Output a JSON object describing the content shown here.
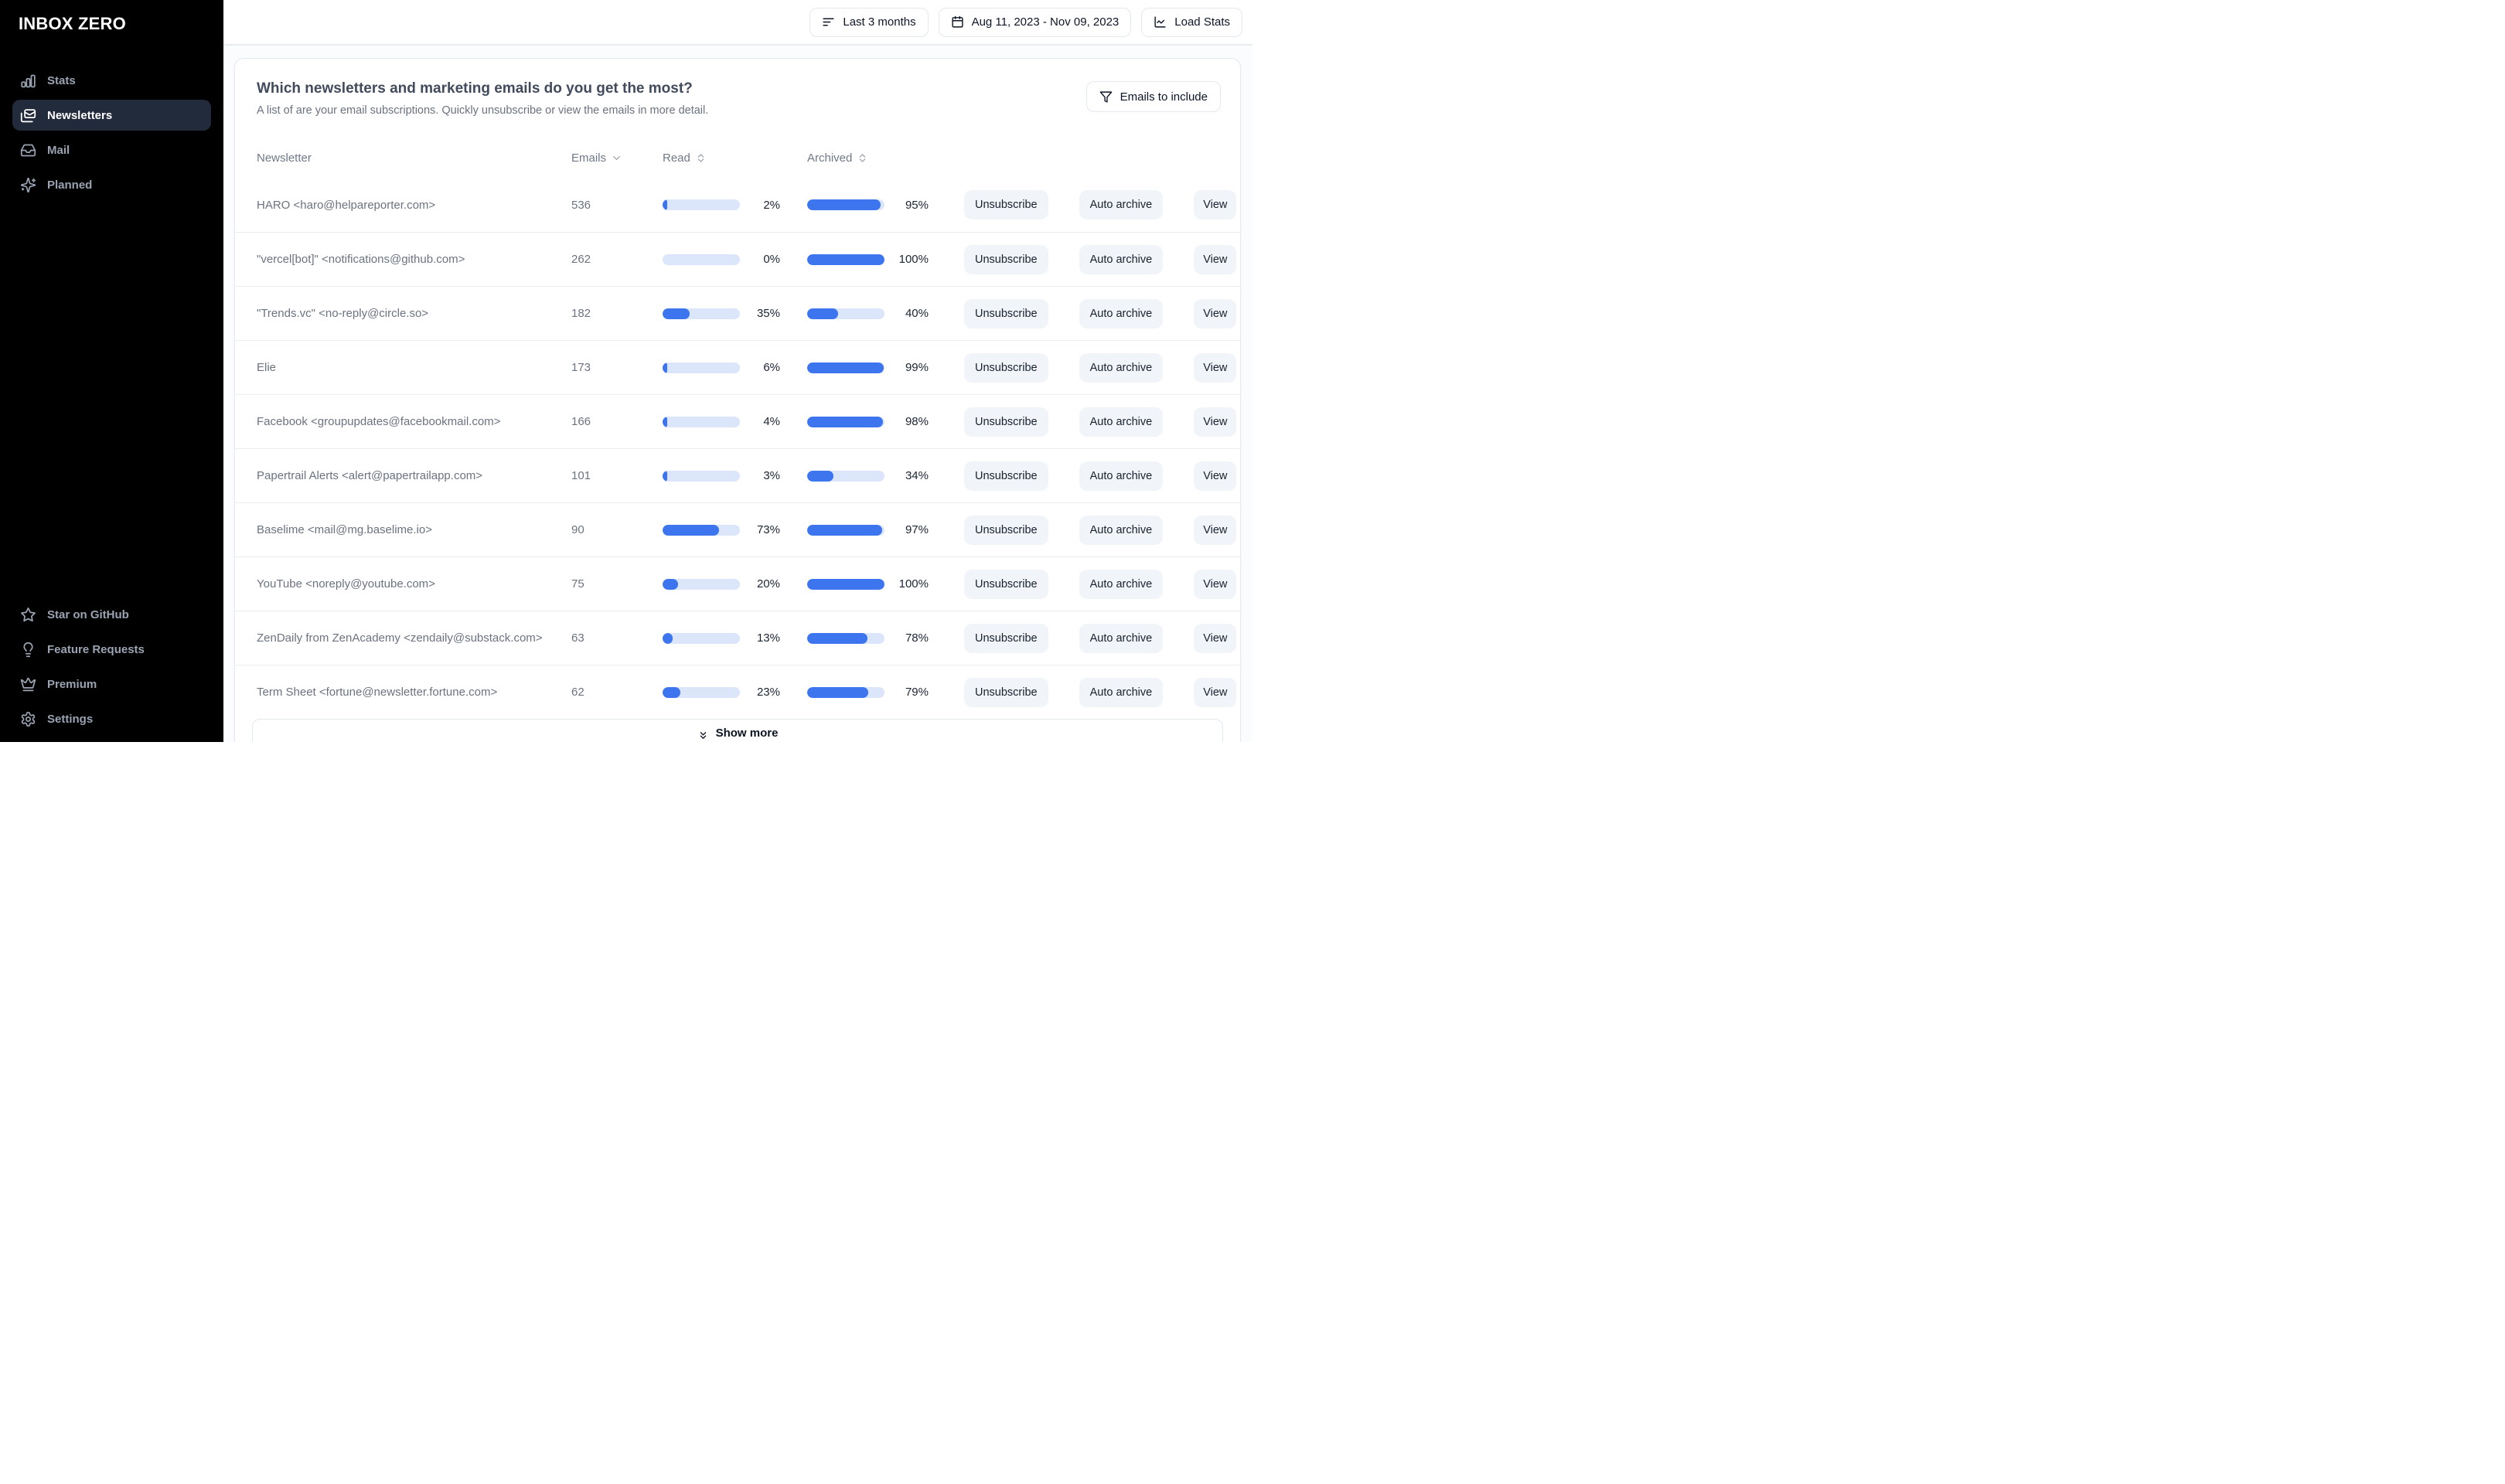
{
  "sidebar": {
    "logo": "INBOX ZERO",
    "nav": [
      {
        "label": "Stats",
        "icon": "bar-chart-icon",
        "active": false
      },
      {
        "label": "Newsletters",
        "icon": "envelope-icon",
        "active": true
      },
      {
        "label": "Mail",
        "icon": "inbox-icon",
        "active": false
      },
      {
        "label": "Planned",
        "icon": "sparkles-icon",
        "active": false
      }
    ],
    "footer_nav": [
      {
        "label": "Star on GitHub",
        "icon": "star-icon"
      },
      {
        "label": "Feature Requests",
        "icon": "lightbulb-icon"
      },
      {
        "label": "Premium",
        "icon": "crown-icon"
      },
      {
        "label": "Settings",
        "icon": "gear-icon"
      }
    ]
  },
  "topbar": {
    "range_button": "Last 3 months",
    "date_button": "Aug 11, 2023 - Nov 09, 2023",
    "load_stats_button": "Load Stats"
  },
  "panel": {
    "title": "Which newsletters and marketing emails do you get the most?",
    "subtitle": "A list of are your email subscriptions. Quickly unsubscribe or view the emails in more detail.",
    "filter_button": "Emails to include",
    "table": {
      "columns": [
        "Newsletter",
        "Emails",
        "Read",
        "Archived"
      ],
      "actions": [
        "Unsubscribe",
        "Auto archive",
        "View"
      ],
      "show_more": "Show more",
      "rows": [
        {
          "name": "HARO <haro@helpareporter.com>",
          "emails": "536",
          "read_pct": 2,
          "archived_pct": 95
        },
        {
          "name": "\"vercel[bot]\" <notifications@github.com>",
          "emails": "262",
          "read_pct": 0,
          "archived_pct": 100
        },
        {
          "name": "\"Trends.vc\" <no-reply@circle.so>",
          "emails": "182",
          "read_pct": 35,
          "archived_pct": 40
        },
        {
          "name": "Elie",
          "emails": "173",
          "read_pct": 6,
          "archived_pct": 99
        },
        {
          "name": "Facebook <groupupdates@facebookmail.com>",
          "emails": "166",
          "read_pct": 4,
          "archived_pct": 98
        },
        {
          "name": "Papertrail Alerts <alert@papertrailapp.com>",
          "emails": "101",
          "read_pct": 3,
          "archived_pct": 34
        },
        {
          "name": "Baselime <mail@mg.baselime.io>",
          "emails": "90",
          "read_pct": 73,
          "archived_pct": 97
        },
        {
          "name": "YouTube <noreply@youtube.com>",
          "emails": "75",
          "read_pct": 20,
          "archived_pct": 100
        },
        {
          "name": "ZenDaily from ZenAcademy <zendaily@substack.com>",
          "emails": "63",
          "read_pct": 13,
          "archived_pct": 78
        },
        {
          "name": "Term Sheet <fortune@newsletter.fortune.com>",
          "emails": "62",
          "read_pct": 23,
          "archived_pct": 79
        }
      ]
    }
  },
  "colors": {
    "accent_blue": "#3d75ef",
    "bar_track": "#dbe6fb",
    "sidebar_bg": "#000000",
    "sidebar_active_bg": "#212b3b",
    "percent_text": "#1b2433"
  }
}
